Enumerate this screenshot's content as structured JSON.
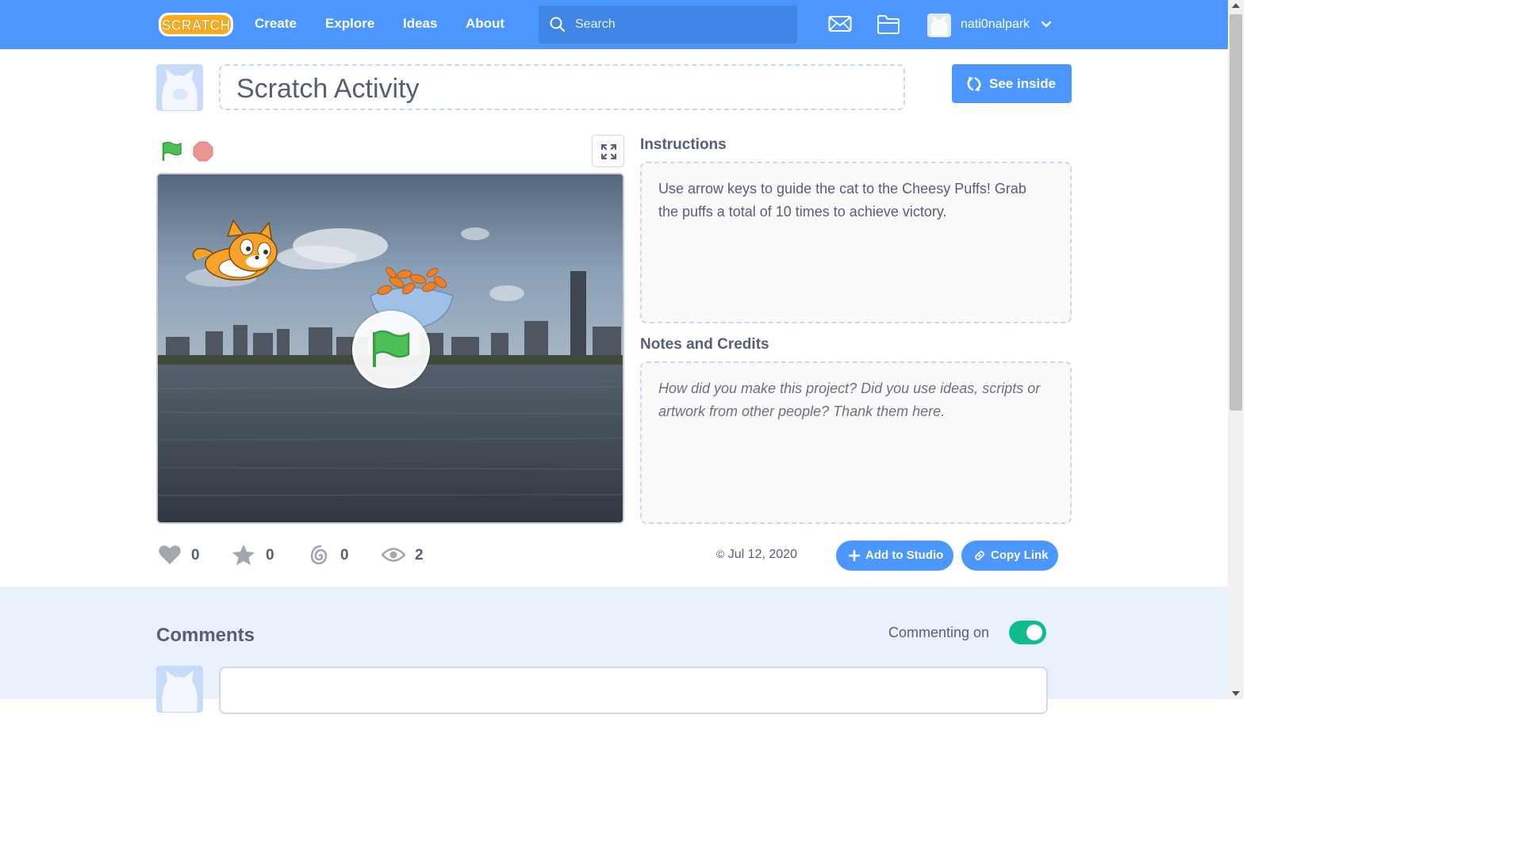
{
  "navbar": {
    "logo_text": "SCRATCH",
    "links": [
      "Create",
      "Explore",
      "Ideas",
      "About"
    ],
    "search_placeholder": "Search",
    "username": "nati0nalpark",
    "icons": [
      "messages-icon",
      "my-stuff-icon"
    ]
  },
  "project": {
    "title": "Scratch Activity",
    "see_inside_label": "See inside",
    "instructions_label": "Instructions",
    "instructions_text": "Use arrow keys to guide the cat to the Cheesy Puffs! Grab the puffs a total of 10 times to achieve victory.",
    "notes_label": "Notes and Credits",
    "notes_placeholder": "How did you make this project? Did you use ideas, scripts or artwork from other people? Thank them here."
  },
  "stats": {
    "loves": "0",
    "favorites": "0",
    "remixes": "0",
    "views": "2"
  },
  "share": {
    "date": "Jul 12, 2020",
    "add_to_studio_label": "Add to Studio",
    "copy_link_label": "Copy Link"
  },
  "comments": {
    "title": "Comments",
    "commenting_label": "Commenting on",
    "commenting_enabled": true
  },
  "colors": {
    "brand_blue": "#4c97ff",
    "toggle_green": "#0fbd8c",
    "flag_green": "#4cbf56",
    "stop_red": "#ec5959"
  }
}
